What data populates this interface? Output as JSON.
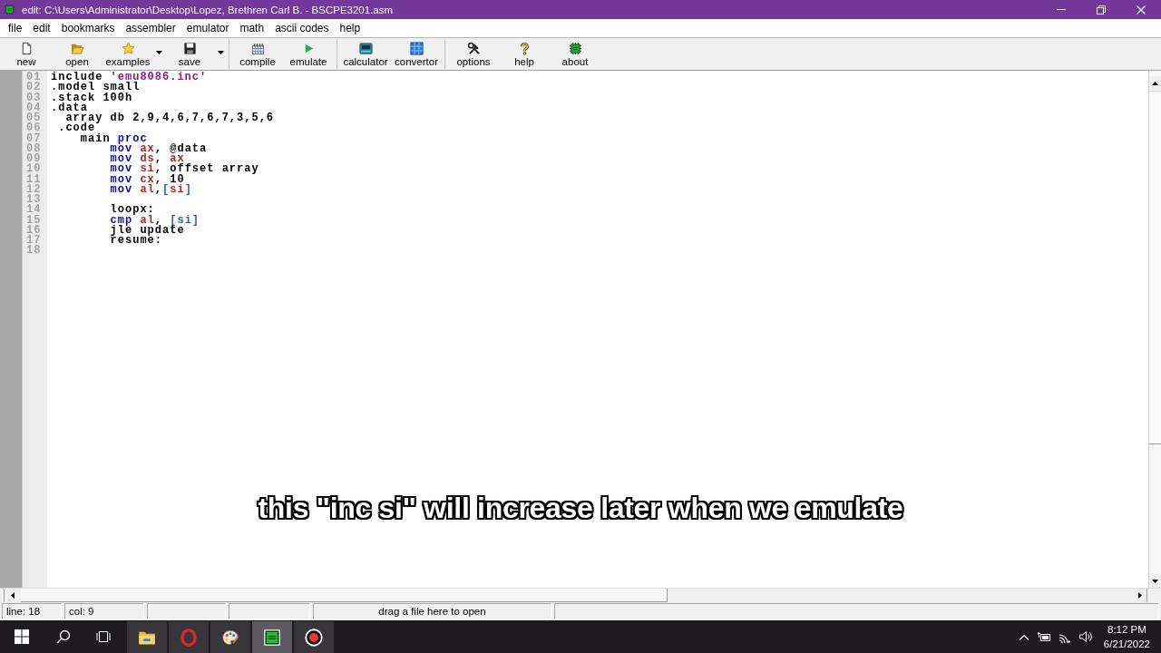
{
  "window": {
    "title": "edit: C:\\Users\\Administrator\\Desktop\\Lopez, Brethren Carl B. - BSCPE3201.asm"
  },
  "menu": [
    "file",
    "edit",
    "bookmarks",
    "assembler",
    "emulator",
    "math",
    "ascii codes",
    "help"
  ],
  "toolbar": [
    [
      {
        "label": "new",
        "dropdown": false
      },
      {
        "label": "open",
        "dropdown": false
      },
      {
        "label": "examples",
        "dropdown": true
      },
      {
        "label": "save",
        "dropdown": true
      }
    ],
    [
      {
        "label": "compile",
        "dropdown": false
      },
      {
        "label": "emulate",
        "dropdown": false
      }
    ],
    [
      {
        "label": "calculator",
        "dropdown": false
      },
      {
        "label": "convertor",
        "dropdown": false
      }
    ],
    [
      {
        "label": "options",
        "dropdown": false
      },
      {
        "label": "help",
        "dropdown": false
      },
      {
        "label": "about",
        "dropdown": false
      }
    ]
  ],
  "editor": {
    "lines": [
      {
        "number": "01",
        "tokens": [
          {
            "text": "include ",
            "kind": "plain"
          },
          {
            "text": "'emu8086.inc'",
            "kind": "string"
          }
        ]
      },
      {
        "number": "02",
        "tokens": [
          {
            "text": ".model small",
            "kind": "plain"
          }
        ]
      },
      {
        "number": "03",
        "tokens": [
          {
            "text": ".stack 100h",
            "kind": "plain"
          }
        ]
      },
      {
        "number": "04",
        "tokens": [
          {
            "text": ".data",
            "kind": "plain"
          }
        ]
      },
      {
        "number": "05",
        "tokens": [
          {
            "text": "  array db 2,9,4,6,7,6,7,3,5,6",
            "kind": "plain"
          }
        ]
      },
      {
        "number": "06",
        "tokens": [
          {
            "text": " .code",
            "kind": "plain"
          }
        ]
      },
      {
        "number": "07",
        "tokens": [
          {
            "text": "    main ",
            "kind": "plain"
          },
          {
            "text": "proc",
            "kind": "keyword"
          }
        ]
      },
      {
        "number": "08",
        "tokens": [
          {
            "text": "        mov ",
            "kind": "keyword"
          },
          {
            "text": "ax",
            "kind": "register"
          },
          {
            "text": ", @data",
            "kind": "plain"
          }
        ]
      },
      {
        "number": "09",
        "tokens": [
          {
            "text": "        mov ",
            "kind": "keyword"
          },
          {
            "text": "ds",
            "kind": "register"
          },
          {
            "text": ", ",
            "kind": "plain"
          },
          {
            "text": "ax",
            "kind": "register"
          }
        ]
      },
      {
        "number": "10",
        "tokens": [
          {
            "text": "        mov ",
            "kind": "keyword"
          },
          {
            "text": "si",
            "kind": "register"
          },
          {
            "text": ", offset array",
            "kind": "plain"
          }
        ]
      },
      {
        "number": "11",
        "tokens": [
          {
            "text": "        mov ",
            "kind": "keyword"
          },
          {
            "text": "cx",
            "kind": "register"
          },
          {
            "text": ", 10",
            "kind": "plain"
          }
        ]
      },
      {
        "number": "12",
        "tokens": [
          {
            "text": "        mov ",
            "kind": "keyword"
          },
          {
            "text": "al",
            "kind": "register"
          },
          {
            "text": ",",
            "kind": "plain"
          },
          {
            "text": "[",
            "kind": "memory"
          },
          {
            "text": "si",
            "kind": "register"
          },
          {
            "text": "]",
            "kind": "memory"
          }
        ]
      },
      {
        "number": "13"
      },
      {
        "number": "14",
        "tokens": [
          {
            "text": "        loopx:",
            "kind": "plain"
          }
        ]
      },
      {
        "number": "15",
        "tokens": [
          {
            "text": "        cmp ",
            "kind": "keyword"
          },
          {
            "text": "al",
            "kind": "register"
          },
          {
            "text": ", ",
            "kind": "plain"
          },
          {
            "text": "[si]",
            "kind": "memory"
          }
        ]
      },
      {
        "number": "16",
        "tokens": [
          {
            "text": "        jle update",
            "kind": "plain"
          }
        ]
      },
      {
        "number": "17",
        "tokens": [
          {
            "text": "        resume:",
            "kind": "plain"
          }
        ]
      },
      {
        "number": "18"
      }
    ]
  },
  "caption": "this \"inc si\" will increase later when we emulate",
  "status_bar": {
    "line": "line: 18",
    "col": "col: 9",
    "hint": "drag a file here to open"
  },
  "taskbar": {
    "apps": [
      {
        "selected": false
      },
      {
        "selected": false
      },
      {
        "selected": false
      },
      {
        "selected": true
      },
      {
        "selected": false
      }
    ],
    "clock": {
      "time": "8:12 PM",
      "date": "6/21/2022"
    }
  }
}
